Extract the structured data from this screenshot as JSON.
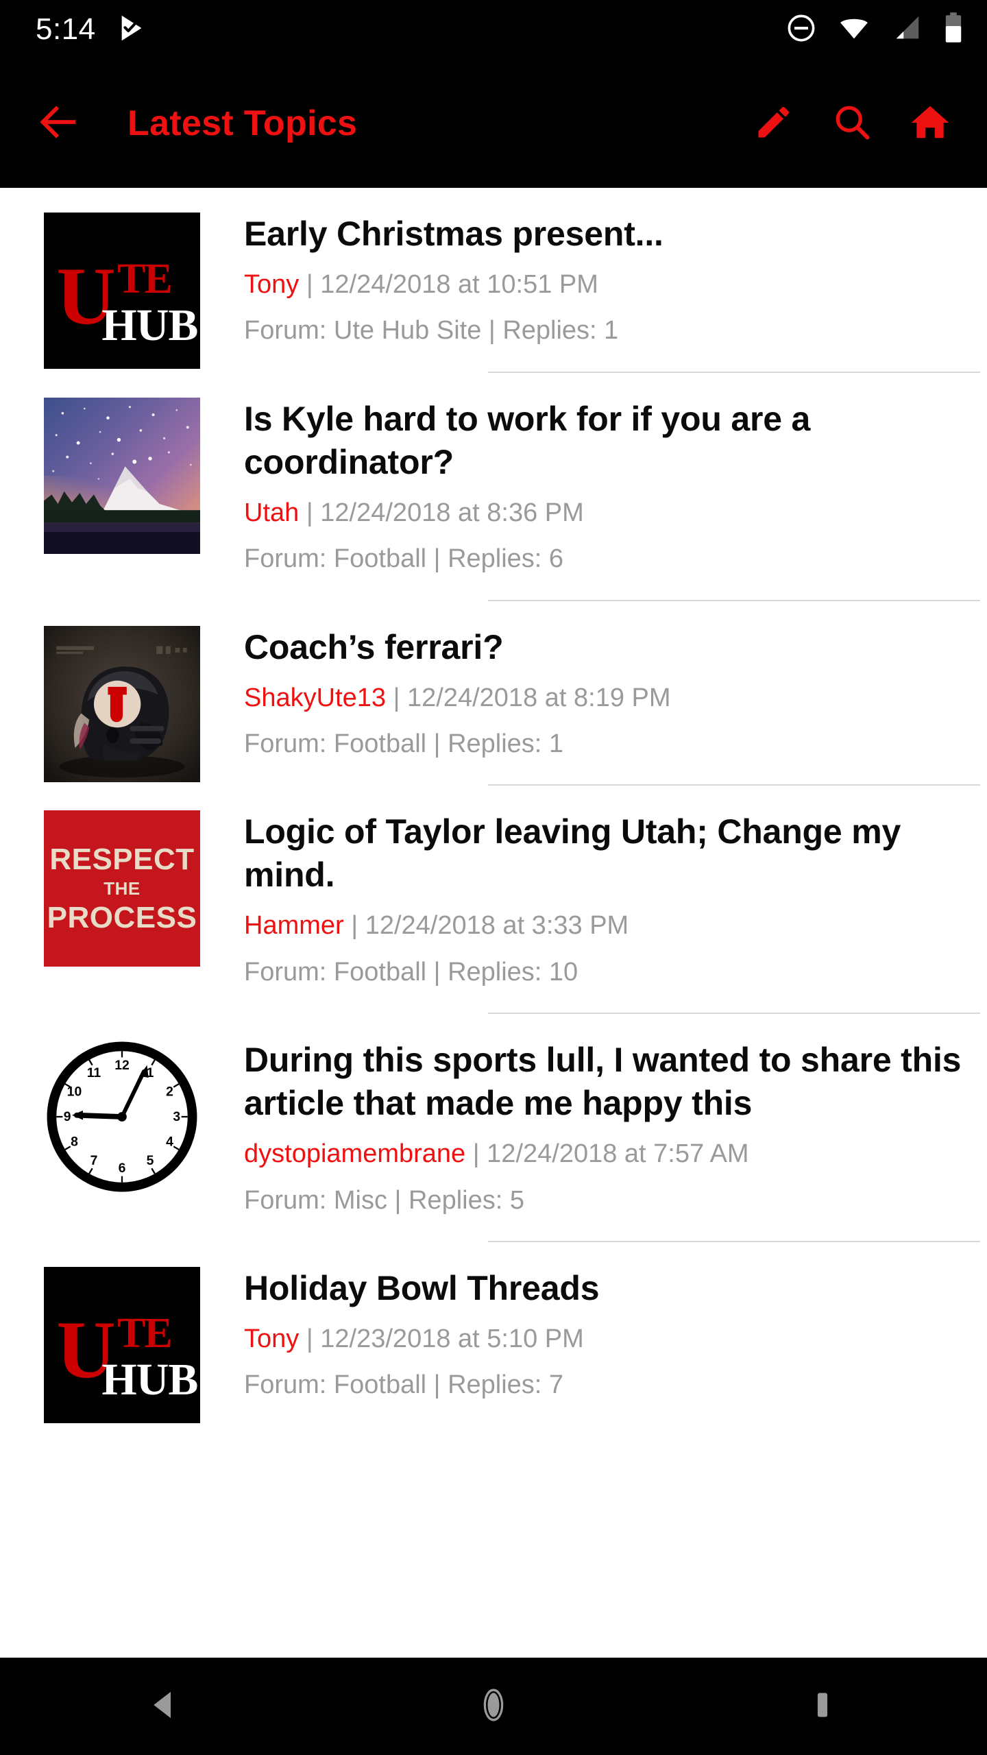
{
  "status_bar": {
    "time": "5:14",
    "notification_icons": [
      "play-store-icon"
    ],
    "system_icons": [
      "do-not-disturb-icon",
      "wifi-icon",
      "cellular-signal-icon",
      "battery-icon"
    ]
  },
  "app_bar": {
    "back_icon": "arrow-back-icon",
    "title": "Latest Topics",
    "actions": [
      {
        "icon": "pencil-compose-icon",
        "name": "compose"
      },
      {
        "icon": "search-icon",
        "name": "search"
      },
      {
        "icon": "home-icon",
        "name": "home"
      }
    ],
    "background_color": "#000000",
    "accent_color": "#EE1111"
  },
  "topics": [
    {
      "title": "Early Christmas present...",
      "author": "Tony",
      "separator": "|",
      "timestamp": "12/24/2018 at 10:51 PM",
      "subline": "Forum: Ute Hub Site | Replies: 1",
      "forum": "Ute Hub Site",
      "replies": "1",
      "avatar": "ute-hub-logo"
    },
    {
      "title": "Is Kyle hard to work for if you are a coordinator?",
      "author": "Utah",
      "separator": "|",
      "timestamp": "12/24/2018 at 8:36 PM",
      "subline": "Forum: Football | Replies: 6",
      "forum": "Football",
      "replies": "6",
      "avatar": "starry-mountain-photo"
    },
    {
      "title": "Coach’s ferrari?",
      "author": "ShakyUte13",
      "separator": "|",
      "timestamp": "12/24/2018 at 8:19 PM",
      "subline": "Forum: Football | Replies: 1",
      "forum": "Football",
      "replies": "1",
      "avatar": "utes-helmet-photo"
    },
    {
      "title": "Logic of Taylor leaving Utah; Change my mind.",
      "author": "Hammer",
      "separator": "|",
      "timestamp": "12/24/2018 at 3:33 PM",
      "subline": "Forum: Football | Replies: 10",
      "forum": "Football",
      "replies": "10",
      "avatar": "respect-the-process-graphic",
      "avatar_text": {
        "line1": "RESPECT",
        "line2": "THE",
        "line3": "PROCESS"
      }
    },
    {
      "title": "During this sports lull, I wanted to share this article that made me happy this",
      "author": "dystopiamembrane",
      "separator": "|",
      "timestamp": "12/24/2018 at 7:57 AM",
      "subline": "Forum: Misc | Replies: 5",
      "forum": "Misc",
      "replies": "5",
      "avatar": "analog-clock-graphic"
    },
    {
      "title": "Holiday Bowl Threads",
      "author": "Tony",
      "separator": "|",
      "timestamp": "12/23/2018 at 5:10 PM",
      "subline": "Forum: Football | Replies: 7",
      "forum": "Football",
      "replies": "7",
      "avatar": "ute-hub-logo"
    }
  ],
  "nav_bar": {
    "buttons": [
      {
        "icon": "nav-back-icon",
        "name": "back"
      },
      {
        "icon": "nav-home-icon",
        "name": "home"
      },
      {
        "icon": "nav-recents-icon",
        "name": "recents"
      }
    ]
  },
  "colors": {
    "accent_red": "#EE1111",
    "meta_gray": "#9a9a9a",
    "divider": "#d8d8d8",
    "bar_black": "#000000"
  }
}
